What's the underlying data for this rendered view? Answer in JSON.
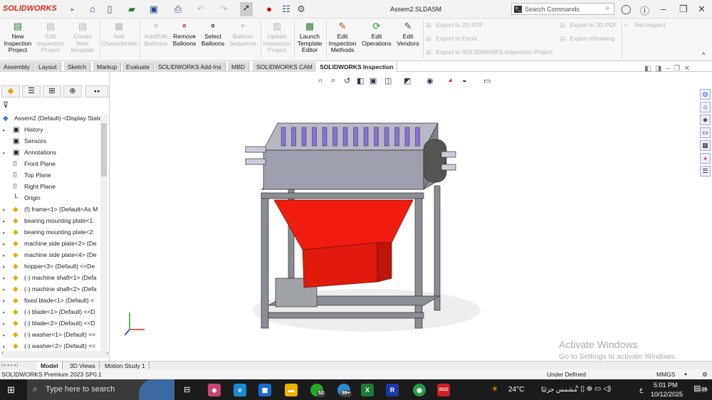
{
  "titlebar": {
    "logo": "SOLIDWORKS",
    "document_title": "Assem2.SLDASM",
    "search_placeholder": "Search Commands"
  },
  "ribbon": {
    "buttons": [
      {
        "label": "New Inspection Project",
        "enabled": true
      },
      {
        "label": "Edit Inspection Project",
        "enabled": false
      },
      {
        "label": "Create New template",
        "enabled": false
      },
      {
        "label": "Add Characteristic",
        "enabled": false
      },
      {
        "label": "Add/Edit Balloons",
        "enabled": false
      },
      {
        "label": "Remove Balloons",
        "enabled": true
      },
      {
        "label": "Select Balloons",
        "enabled": true
      },
      {
        "label": "Balloon Sequence",
        "enabled": false
      },
      {
        "label": "Update Inspection Project",
        "enabled": false
      },
      {
        "label": "Launch Template Editor",
        "enabled": true
      },
      {
        "label": "Edit Inspection Methods",
        "enabled": true
      },
      {
        "label": "Edit Operations",
        "enabled": true
      },
      {
        "label": "Edit Vendors",
        "enabled": true
      }
    ],
    "exports": [
      "Export to 2D PDF",
      "Export to Excel",
      "Export to SOLIDWORKS Inspection Project",
      "Export to 3D PDF",
      "Export eDrawing",
      "Net-Inspect"
    ]
  },
  "tabs": [
    "Assembly",
    "Layout",
    "Sketch",
    "Markup",
    "Evaluate",
    "SOLIDWORKS Add-Ins",
    "MBD",
    "SOLIDWORKS CAM",
    "SOLIDWORKS Inspection"
  ],
  "tree": {
    "root": "Assem2 (Default) <Display State",
    "items": [
      {
        "label": "History",
        "type": "folder",
        "expand": true
      },
      {
        "label": "Sensors",
        "type": "folder",
        "expand": false
      },
      {
        "label": "Annotations",
        "type": "folder",
        "expand": true
      },
      {
        "label": "Front Plane",
        "type": "plane",
        "expand": false
      },
      {
        "label": "Top Plane",
        "type": "plane",
        "expand": false
      },
      {
        "label": "Right Plane",
        "type": "plane",
        "expand": false
      },
      {
        "label": "Origin",
        "type": "origin",
        "expand": false
      },
      {
        "label": "(f) frame<1> (Default<As M",
        "type": "part",
        "expand": true
      },
      {
        "label": "bearing mounting plate<1:",
        "type": "part",
        "expand": true
      },
      {
        "label": "bearing mounting plate<2:",
        "type": "part",
        "expand": true
      },
      {
        "label": "machine side plate<2> (De",
        "type": "part",
        "expand": true
      },
      {
        "label": "machine side plate<4> (De",
        "type": "part",
        "expand": true
      },
      {
        "label": "hopper<3> (Default) <<De",
        "type": "part",
        "expand": true
      },
      {
        "label": "(-) machine shaft<1> (Defa",
        "type": "part",
        "expand": true
      },
      {
        "label": "(-) machine shaft<2> (Defa",
        "type": "part",
        "expand": true
      },
      {
        "label": "fixed blade<1> (Default) <",
        "type": "part",
        "expand": true
      },
      {
        "label": "(-) blade<1> (Default) <<D",
        "type": "part",
        "expand": true
      },
      {
        "label": "(-) blade<2> (Default) <<D",
        "type": "part",
        "expand": true
      },
      {
        "label": "(-) washer<1> (Default) <<",
        "type": "part",
        "expand": true
      },
      {
        "label": "(-) washer<2> (Default) <<",
        "type": "part",
        "expand": true
      }
    ]
  },
  "bottom_tabs": [
    "Model",
    "3D Views",
    "Motion Study 1"
  ],
  "status": {
    "version": "SOLIDWORKS Premium 2023 SP0.1",
    "state": "Under Defined",
    "units": "MMGS"
  },
  "watermark": {
    "line1": "Activate Windows",
    "line2": "Go to Settings to activate Windows."
  },
  "taskbar": {
    "search_placeholder": "Type here to search",
    "weather": "24°C",
    "weather_text": "مشمس جزئيًا",
    "time": "5:01 PM",
    "date": "10/12/2025",
    "whatsapp_badge": "52",
    "telegram_badge": "99+",
    "notif_badge": "16",
    "lang": "ع",
    "sw_badge": "2023"
  },
  "colors": {
    "hopper": "#ef1c0f",
    "brand": "#d8271d"
  }
}
